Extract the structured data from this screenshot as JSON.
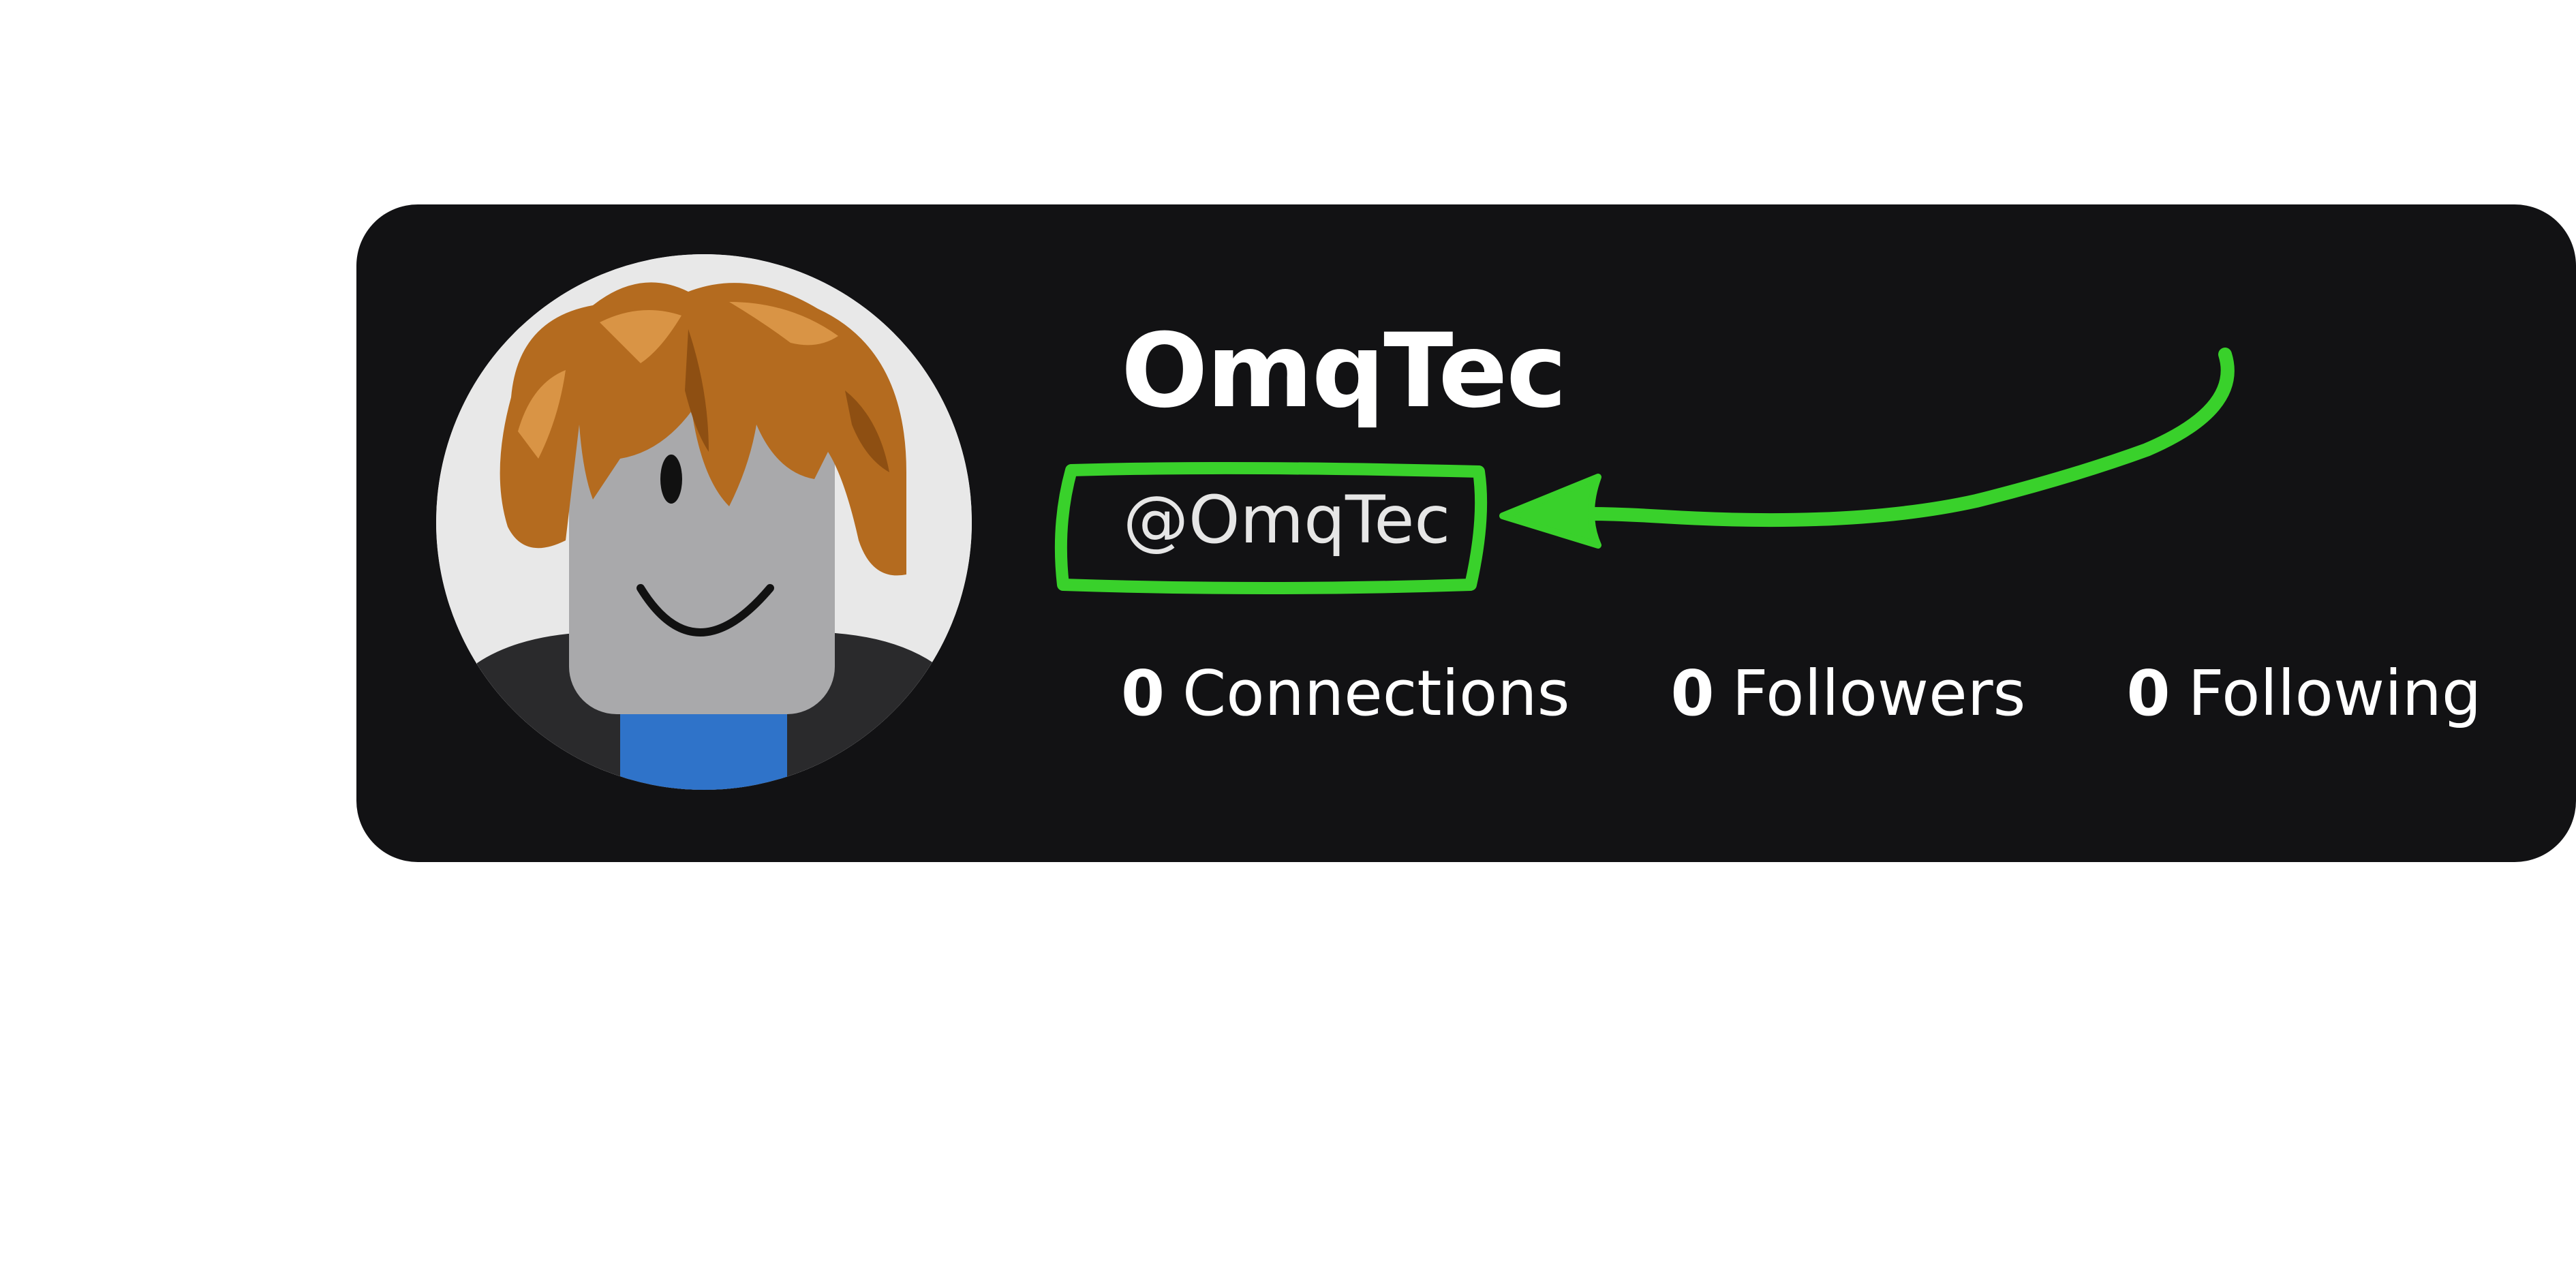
{
  "profile": {
    "display_name": "OmqTec",
    "username": "@OmqTec",
    "stats": {
      "connections": {
        "count": "0",
        "label": "Connections"
      },
      "followers": {
        "count": "0",
        "label": "Followers"
      },
      "following": {
        "count": "0",
        "label": "Following"
      }
    }
  },
  "avatar": {
    "icon": "roblox-avatar-icon"
  },
  "annotation": {
    "color": "#39d12b",
    "icon": "arrow-icon"
  },
  "colors": {
    "card_background": "#121214",
    "page_background": "#ffffff",
    "text": "#ffffff"
  }
}
